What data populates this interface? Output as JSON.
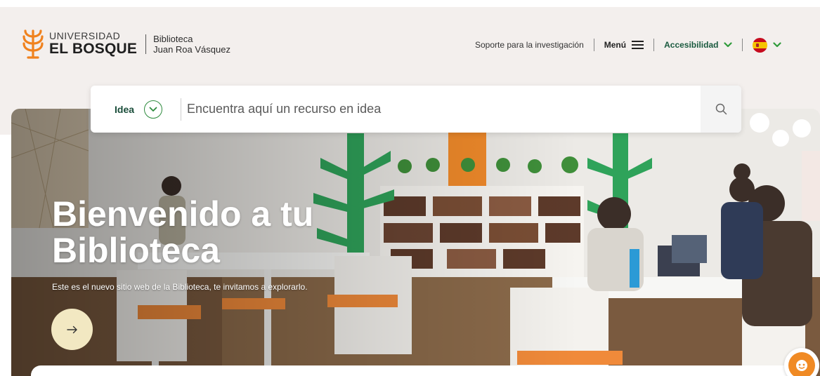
{
  "brand": {
    "university_line": "UNIVERSIDAD",
    "name": "EL BOSQUE",
    "library_line1": "Biblioteca",
    "library_line2": "Juan Roa Vásquez",
    "logo_icon": "el-bosque-tree-logo",
    "accent_color": "#f0821e"
  },
  "nav": {
    "research_support": "Soporte para la investigación",
    "menu_label": "Menú",
    "menu_icon": "hamburger-icon",
    "accessibility_label": "Accesibilidad",
    "language_icon": "spain-flag-icon",
    "accent_color": "#2e9b3a"
  },
  "search": {
    "scope_label": "Idea",
    "scope_icon": "chevron-down-circle-icon",
    "placeholder": "Encuentra aquí un recurso en idea",
    "value": "",
    "submit_icon": "search-icon"
  },
  "hero": {
    "title": "Bienvenido a tu Biblioteca",
    "subtitle": "Este es el nuevo sitio web de la Biblioteca, te invitamos a explorarlo.",
    "cta_icon": "arrow-right-icon",
    "cta_color": "#f2e8c2"
  },
  "chat": {
    "icon": "chat-assistant-icon",
    "color": "#f08a24"
  }
}
